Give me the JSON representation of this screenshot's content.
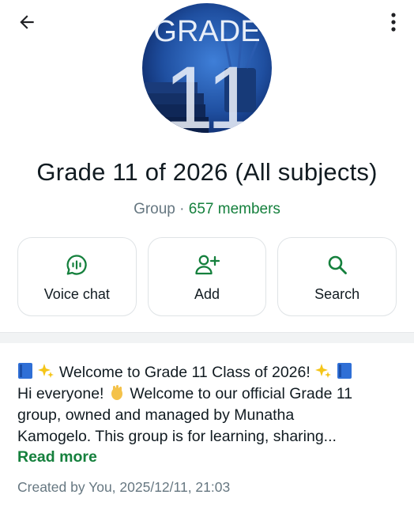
{
  "header": {
    "back_icon": "arrow-left-icon",
    "menu_icon": "vertical-dots-icon"
  },
  "group": {
    "avatar_text": "GRADE",
    "avatar_number": "11",
    "name": "Grade 11 of 2026 (All subjects)",
    "type_label": "Group",
    "separator": "·",
    "members_label": "657 members"
  },
  "actions": [
    {
      "label": "Voice chat",
      "icon": "voice-chat-icon"
    },
    {
      "label": "Add",
      "icon": "add-person-icon"
    },
    {
      "label": "Search",
      "icon": "search-icon"
    }
  ],
  "description": {
    "line1": "Welcome to Grade 11 Class of 2026!",
    "line2_a": "Hi everyone!",
    "line2_b": "Welcome to our official Grade 11",
    "line3": "group, owned and managed by Munatha",
    "line4": "Kamogelo. This group is for learning, sharing...",
    "read_more": "Read more"
  },
  "created": "Created by You, 2025/12/11, 21:03",
  "colors": {
    "accent_green": "#15803d",
    "muted_text": "#667781",
    "card_border": "#dfe3e6"
  }
}
